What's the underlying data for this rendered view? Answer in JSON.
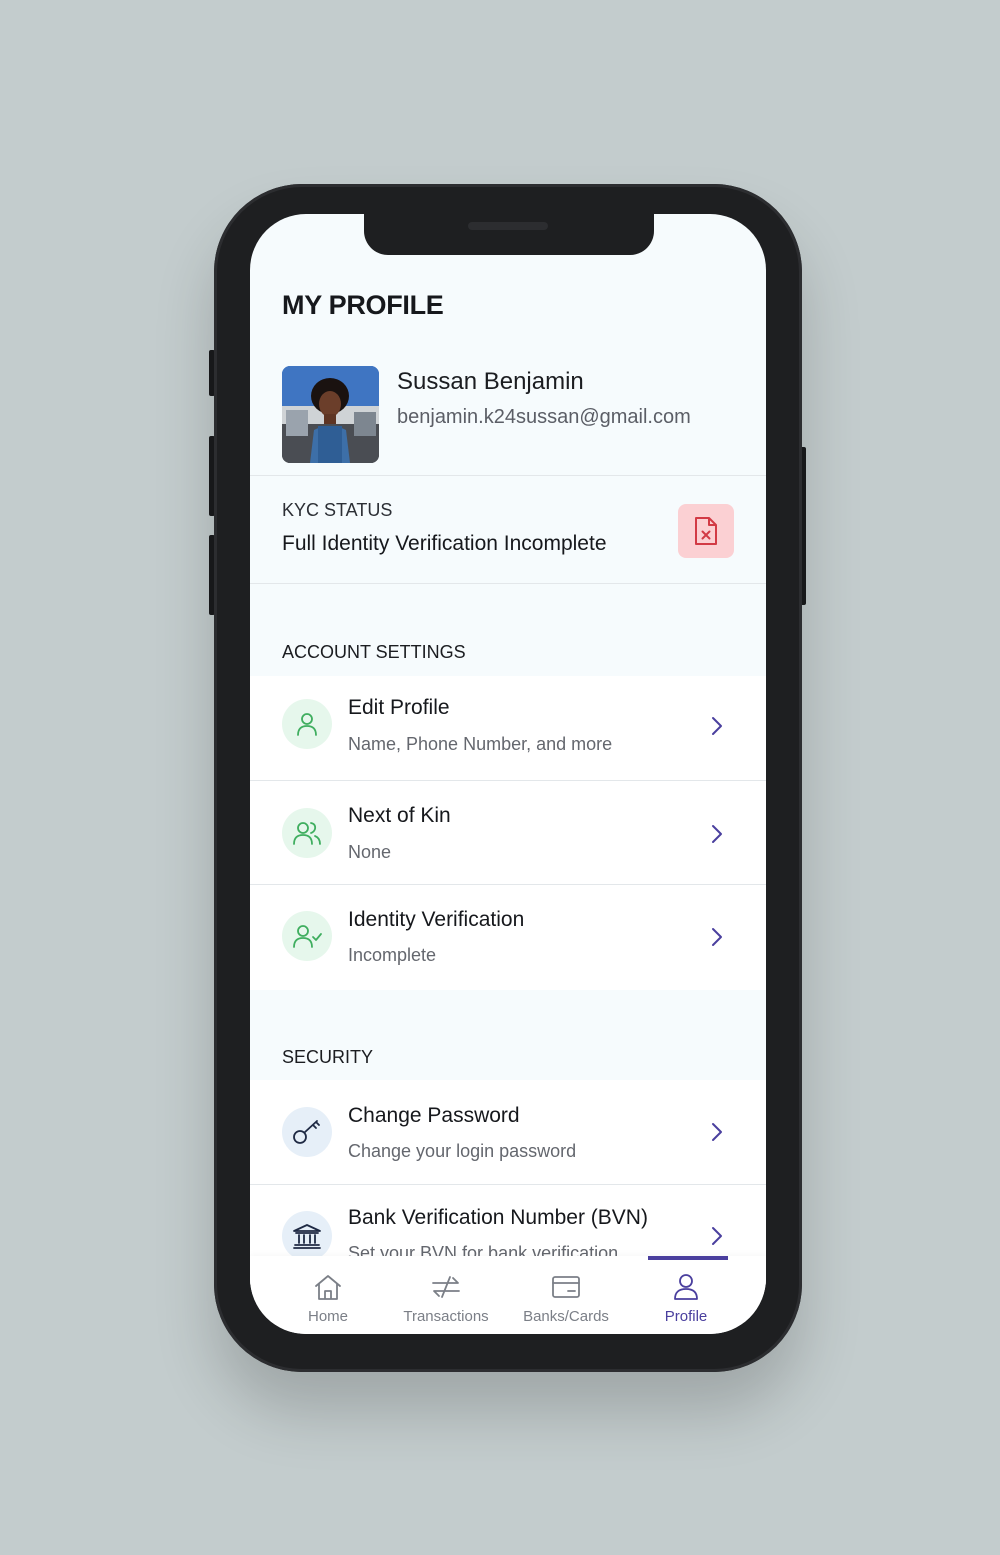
{
  "header": {
    "title": "MY PROFILE"
  },
  "profile": {
    "name": "Sussan Benjamin",
    "email": "benjamin.k24sussan@gmail.com"
  },
  "kyc": {
    "label": "KYC STATUS",
    "status": "Full Identity Verification Incomplete",
    "badge_icon": "file-x-icon",
    "badge_color": "#fbd0d3"
  },
  "account_settings": {
    "label": "ACCOUNT SETTINGS",
    "items": [
      {
        "title": "Edit Profile",
        "subtitle": "Name, Phone Number, and more",
        "icon": "user-icon"
      },
      {
        "title": "Next of Kin",
        "subtitle": "None",
        "icon": "users-icon"
      },
      {
        "title": "Identity Verification",
        "subtitle": "Incomplete",
        "icon": "user-check-icon"
      }
    ]
  },
  "security": {
    "label": "SECURITY",
    "items": [
      {
        "title": "Change Password",
        "subtitle": "Change your login password",
        "icon": "key-icon"
      },
      {
        "title": "Bank Verification Number (BVN)",
        "subtitle": "Set your BVN for bank verification",
        "icon": "bank-icon"
      }
    ]
  },
  "tabbar": {
    "tabs": [
      {
        "label": "Home",
        "icon": "home-icon"
      },
      {
        "label": "Transactions",
        "icon": "transfer-icon"
      },
      {
        "label": "Banks/Cards",
        "icon": "card-icon"
      },
      {
        "label": "Profile",
        "icon": "user-icon",
        "active": true
      }
    ],
    "active_color": "#4a3f9e"
  }
}
